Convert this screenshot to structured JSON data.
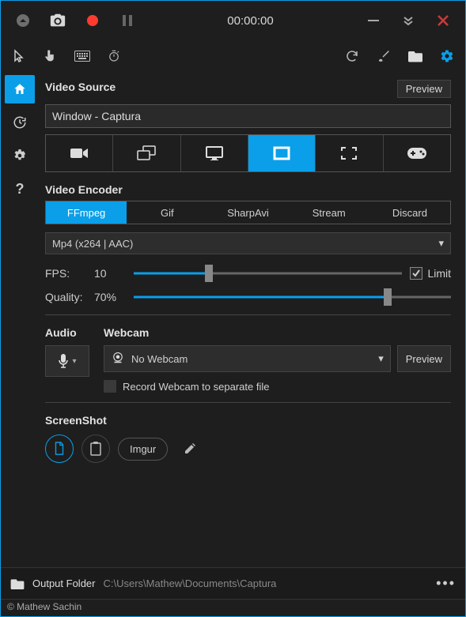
{
  "titlebar": {
    "timer": "00:00:00"
  },
  "colors": {
    "accent": "#0a9fe8",
    "record": "#ff3b30",
    "close": "#cc3a3a"
  },
  "videoSource": {
    "title": "Video Source",
    "previewLabel": "Preview",
    "selected": "Window  -  Captura",
    "modes": [
      "camera",
      "screen",
      "monitor",
      "region",
      "fullscreen",
      "game"
    ],
    "activeMode": "region"
  },
  "videoEncoder": {
    "title": "Video Encoder",
    "tabs": [
      "FFmpeg",
      "Gif",
      "SharpAvi",
      "Stream",
      "Discard"
    ],
    "activeTab": "FFmpeg",
    "codec": "Mp4 (x264 | AAC)"
  },
  "fps": {
    "label": "FPS:",
    "value": "10",
    "percent": 28,
    "limitLabel": "Limit",
    "limitChecked": true
  },
  "quality": {
    "label": "Quality:",
    "value": "70%",
    "percent": 80
  },
  "audio": {
    "title": "Audio"
  },
  "webcam": {
    "title": "Webcam",
    "selected": "No Webcam",
    "previewLabel": "Preview",
    "separateLabel": "Record Webcam to separate file",
    "separateChecked": false
  },
  "screenshot": {
    "title": "ScreenShot",
    "imgurLabel": "Imgur"
  },
  "footer": {
    "label": "Output Folder",
    "path": "C:\\Users\\Mathew\\Documents\\Captura"
  },
  "copyright": "© Mathew Sachin"
}
